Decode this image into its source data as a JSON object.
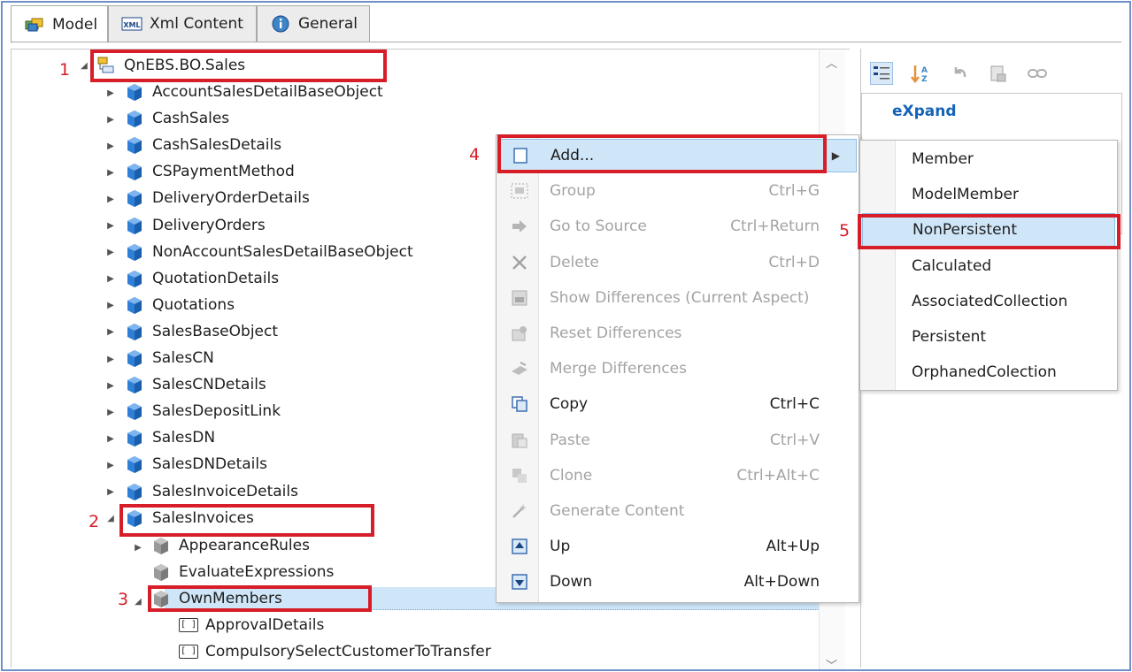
{
  "tabs": [
    {
      "label": "Model",
      "icon": "model-icon",
      "active": true
    },
    {
      "label": "Xml Content",
      "icon": "xml-icon",
      "active": false
    },
    {
      "label": "General",
      "icon": "info-icon",
      "active": false
    }
  ],
  "tree": {
    "root": "QnEBS.BO.Sales",
    "classes": [
      "AccountSalesDetailBaseObject",
      "CashSales",
      "CashSalesDetails",
      "CSPaymentMethod",
      "DeliveryOrderDetails",
      "DeliveryOrders",
      "NonAccountSalesDetailBaseObject",
      "QuotationDetails",
      "Quotations",
      "SalesBaseObject",
      "SalesCN",
      "SalesCNDetails",
      "SalesDepositLink",
      "SalesDN",
      "SalesDNDetails",
      "SalesInvoiceDetails",
      "SalesInvoices"
    ],
    "children": [
      "AppearanceRules",
      "EvaluateExpressions",
      "OwnMembers"
    ],
    "members": [
      "ApprovalDetails",
      "CompulsorySelectCustomerToTransfer"
    ]
  },
  "steps": [
    "1",
    "2",
    "3",
    "4",
    "5"
  ],
  "properties": {
    "category": "eXpand"
  },
  "context_menu": {
    "items": [
      {
        "label": "Add...",
        "shortcut": "",
        "icon": "add-icon",
        "disabled": false,
        "submenu": true
      },
      {
        "label": "Group",
        "shortcut": "Ctrl+G",
        "icon": "group-icon",
        "disabled": true
      },
      {
        "label": "Go to Source",
        "shortcut": "Ctrl+Return",
        "icon": "go-to-source-icon",
        "disabled": true
      },
      {
        "label": "Delete",
        "shortcut": "Ctrl+D",
        "icon": "delete-icon",
        "disabled": true
      },
      {
        "label": "Show Differences (Current Aspect)",
        "shortcut": "",
        "icon": "show-differences-icon",
        "disabled": true
      },
      {
        "label": "Reset Differences",
        "shortcut": "",
        "icon": "reset-differences-icon",
        "disabled": true
      },
      {
        "label": "Merge Differences",
        "shortcut": "",
        "icon": "merge-differences-icon",
        "disabled": true
      },
      {
        "label": "Copy",
        "shortcut": "Ctrl+C",
        "icon": "copy-icon",
        "disabled": false
      },
      {
        "label": "Paste",
        "shortcut": "Ctrl+V",
        "icon": "paste-icon",
        "disabled": true
      },
      {
        "label": "Clone",
        "shortcut": "Ctrl+Alt+C",
        "icon": "clone-icon",
        "disabled": true
      },
      {
        "label": "Generate Content",
        "shortcut": "",
        "icon": "generate-content-icon",
        "disabled": true
      },
      {
        "label": "Up",
        "shortcut": "Alt+Up",
        "icon": "up-icon",
        "disabled": false
      },
      {
        "label": "Down",
        "shortcut": "Alt+Down",
        "icon": "down-icon",
        "disabled": false
      }
    ]
  },
  "submenu": {
    "items": [
      "Member",
      "ModelMember",
      "NonPersistent",
      "Calculated",
      "AssociatedCollection",
      "Persistent",
      "OrphanedColection"
    ]
  },
  "colors": {
    "highlight_box": "#d71d27",
    "selection": "#cfe6f8",
    "cube_blue": "#2f7fd6",
    "category_text": "#1463b8"
  }
}
